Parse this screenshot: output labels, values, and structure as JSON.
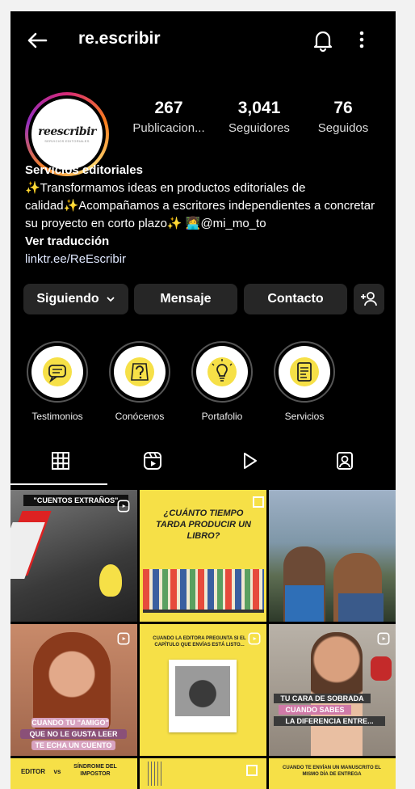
{
  "header": {
    "username": "re.escribir"
  },
  "profile": {
    "logo_text": "reescribir",
    "logo_subtitle": "SERVICIOS EDITORIALES",
    "stats": [
      {
        "value": "267",
        "label": "Publicacion..."
      },
      {
        "value": "3,041",
        "label": "Seguidores"
      },
      {
        "value": "76",
        "label": "Seguidos"
      }
    ],
    "bio_name": "Servicios editoriales",
    "bio_text": "✨Transformamos ideas en productos editoriales de calidad✨Acompañamos a escritores independientes a concretar su proyecto en corto plazo✨ 👩‍💻@mi_mo_to",
    "translate": "Ver traducción",
    "link": "linktr.ee/ReEscribir"
  },
  "actions": {
    "following": "Siguiendo",
    "message": "Mensaje",
    "contact": "Contacto"
  },
  "highlights": [
    {
      "label": "Testimonios"
    },
    {
      "label": "Conócenos"
    },
    {
      "label": "Portafolio"
    },
    {
      "label": "Servicios"
    }
  ],
  "posts": {
    "p1_caption": "\"CUENTOS EXTRAÑOS\"",
    "p2_caption": "¿CUÁNTO TIEMPO TARDA PRODUCIR UN LIBRO?",
    "p4_caption_a": "CUANDO TU \"AMIGO\"",
    "p4_caption_b": "QUE NO LE GUSTA LEER",
    "p4_caption_c": "TE ECHA UN CUENTO",
    "p5_caption": "CUANDO LA EDITORA PREGUNTA SI EL CAPÍTULO QUE ENVÍAS ESTÁ LISTO...",
    "p6_caption_a": "TU CARA DE SOBRADA",
    "p6_caption_b": "CUANDO SABES",
    "p6_caption_c": "LA DIFERENCIA ENTRE...",
    "p7_caption_a": "EDITOR",
    "p7_caption_b": "vs",
    "p7_caption_c": "SÍNDROME DEL IMPOSTOR",
    "p9_caption": "CUANDO TE ENVÍAN UN MANUSCRITO EL MISMO DÍA DE ENTREGA"
  },
  "colors": {
    "brand_yellow": "#f6e047",
    "button_bg": "#262626",
    "background": "#000000"
  }
}
